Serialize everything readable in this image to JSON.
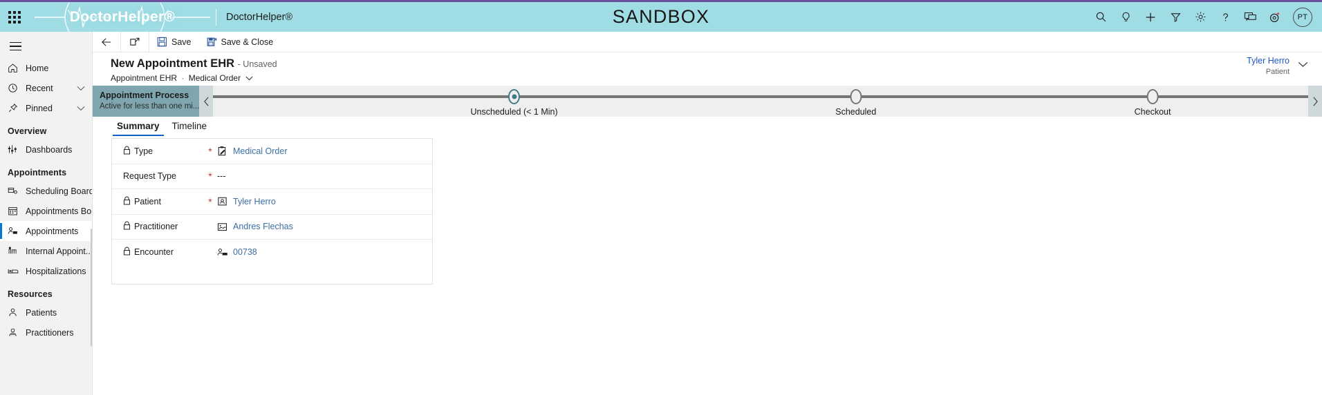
{
  "topbar": {
    "waffle_label": "app-launcher",
    "brand": "DoctorHelper®",
    "app_name": "DoctorHelper®",
    "environment": "SANDBOX",
    "accent_purple": "#6b4fa0",
    "bar_color": "#9FDCE4",
    "icons": [
      {
        "name": "search-icon",
        "title": "Search"
      },
      {
        "name": "lightbulb-icon",
        "title": "Insights"
      },
      {
        "name": "plus-icon",
        "title": "Quick create"
      },
      {
        "name": "filter-icon",
        "title": "Filter"
      },
      {
        "name": "gear-icon",
        "title": "Settings"
      },
      {
        "name": "help-icon",
        "title": "Help"
      },
      {
        "name": "chat-icon",
        "title": "Feedback"
      },
      {
        "name": "notifications-icon",
        "title": "Notifications"
      }
    ],
    "avatar_initials": "PT"
  },
  "leftnav": {
    "items": [
      {
        "label": "Home",
        "icon": "home-icon",
        "chevron": false,
        "selected": false
      },
      {
        "label": "Recent",
        "icon": "clock-icon",
        "chevron": true,
        "selected": false
      },
      {
        "label": "Pinned",
        "icon": "pin-icon",
        "chevron": true,
        "selected": false
      }
    ],
    "groups": [
      {
        "title": "Overview",
        "items": [
          {
            "label": "Dashboards",
            "icon": "dashboard-icon",
            "selected": false
          }
        ]
      },
      {
        "title": "Appointments",
        "items": [
          {
            "label": "Scheduling Board",
            "icon": "scheduling-board-icon",
            "selected": false
          },
          {
            "label": "Appointments Bo...",
            "icon": "calendar-icon",
            "selected": false
          },
          {
            "label": "Appointments",
            "icon": "appointments-icon",
            "selected": true
          },
          {
            "label": "Internal Appoint...",
            "icon": "internal-appointment-icon",
            "selected": false
          },
          {
            "label": "Hospitalizations",
            "icon": "bed-icon",
            "selected": false
          }
        ]
      },
      {
        "title": "Resources",
        "items": [
          {
            "label": "Patients",
            "icon": "patient-icon",
            "selected": false
          },
          {
            "label": "Practitioners",
            "icon": "practitioner-icon",
            "selected": false
          }
        ]
      }
    ]
  },
  "commandbar": {
    "back_label": "back-button",
    "popout_label": "open-in-new-window",
    "save_label": "Save",
    "save_close_label": "Save & Close"
  },
  "record": {
    "title": "New Appointment EHR",
    "unsaved": "- Unsaved",
    "breadcrumb_entity": "Appointment EHR",
    "breadcrumb_sep": "·",
    "breadcrumb_form": "Medical Order",
    "header_patient_name": "Tyler Herro",
    "header_patient_role": "Patient"
  },
  "bpf": {
    "name": "Appointment Process",
    "status": "Active for less than one mi...",
    "prev_label": "previous-stage",
    "next_label": "next-stage",
    "stages": [
      {
        "label": "Unscheduled",
        "duration": "(< 1 Min)",
        "active": true,
        "pos": 27.5
      },
      {
        "label": "Scheduled",
        "duration": "",
        "active": false,
        "pos": 58.7
      },
      {
        "label": "Checkout",
        "duration": "",
        "active": false,
        "pos": 85.8
      }
    ]
  },
  "tabs": [
    {
      "label": "Summary",
      "active": true
    },
    {
      "label": "Timeline",
      "active": false
    }
  ],
  "form": {
    "rows": [
      {
        "label": "Type",
        "locked": true,
        "required": true,
        "value": "Medical Order",
        "value_icon": "medical-order-icon",
        "is_link": true
      },
      {
        "label": "Request Type",
        "locked": false,
        "required": true,
        "value": "---",
        "value_icon": "",
        "is_link": false
      },
      {
        "label": "Patient",
        "locked": true,
        "required": true,
        "value": "Tyler Herro",
        "value_icon": "patient-card-icon",
        "is_link": true
      },
      {
        "label": "Practitioner",
        "locked": true,
        "required": false,
        "value": "Andres Flechas",
        "value_icon": "practitioner-card-icon",
        "is_link": true
      },
      {
        "label": "Encounter",
        "locked": true,
        "required": false,
        "value": "00738",
        "value_icon": "encounter-icon",
        "is_link": true
      }
    ],
    "required_marker": "*"
  }
}
